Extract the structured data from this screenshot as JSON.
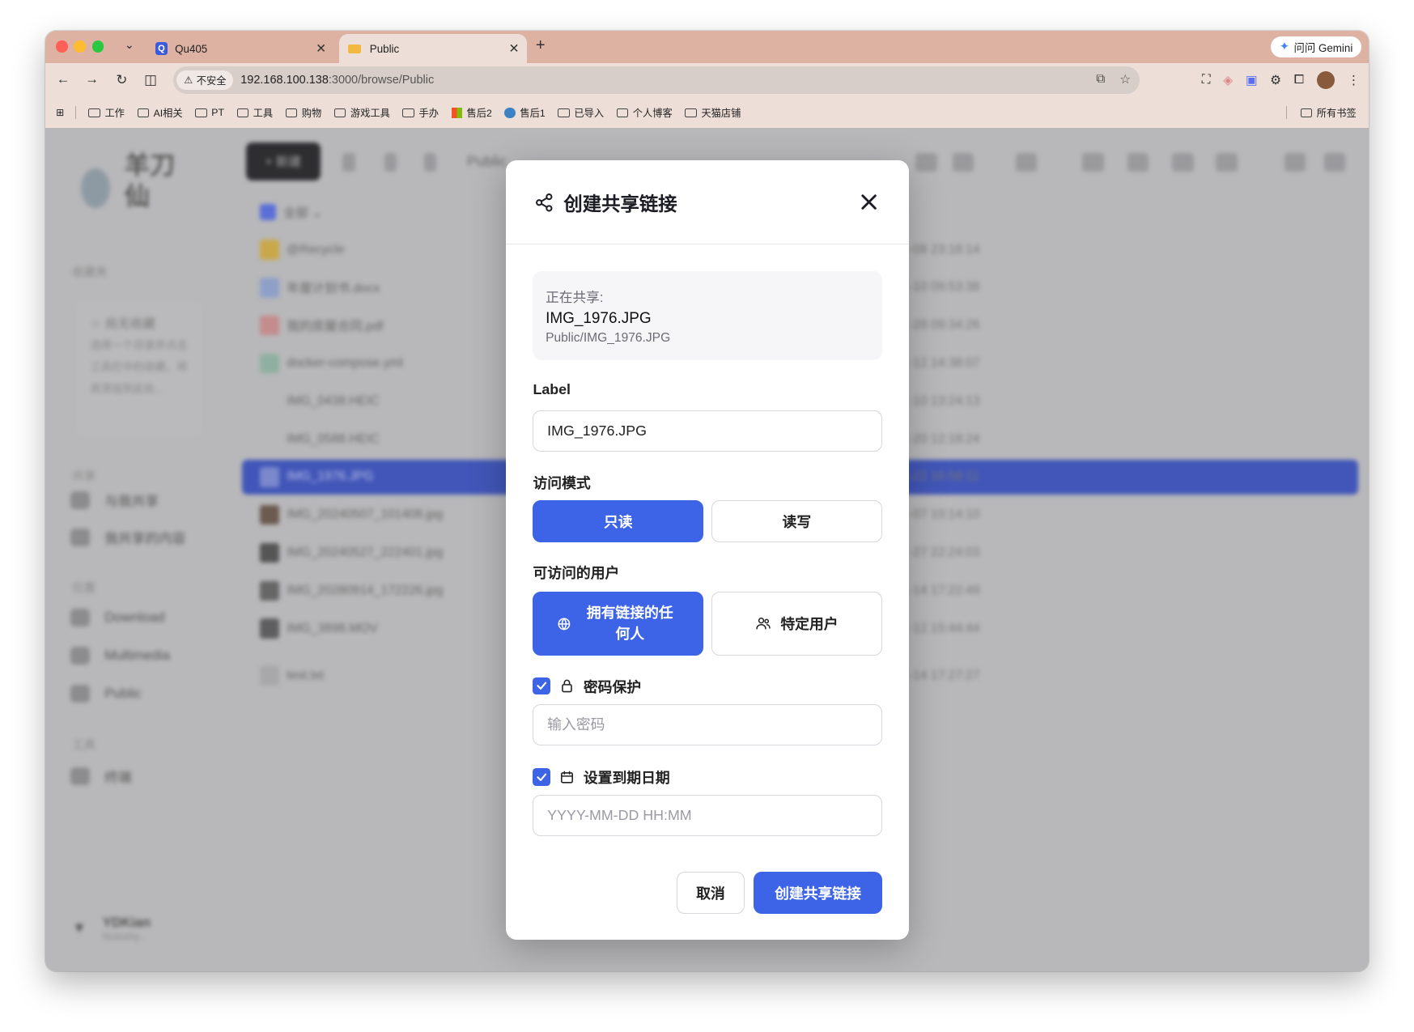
{
  "browser": {
    "tabs": [
      {
        "title": "Qu405"
      },
      {
        "title": "Public"
      }
    ],
    "gemini_label": "问问 Gemini",
    "address": {
      "insecure_label": "不安全",
      "host": "192.168.100.138",
      "rest": ":3000/browse/Public"
    },
    "bookmarks": [
      "工作",
      "AI相关",
      "PT",
      "工具",
      "购物",
      "游戏工具",
      "手办",
      "售后2",
      "售后1",
      "已导入",
      "个人博客",
      "天猫店铺"
    ],
    "bookmarks_all": "所有书签"
  },
  "background": {
    "app_name": "羊刀仙",
    "new_button": "+ 新建",
    "breadcrumb": "Public",
    "sidebar": {
      "section_favorites": "收藏夹",
      "favorites_title": "☆ 尚无收藏",
      "favorites_hint": "选择一个目录并点击工具栏中的收藏，将其添加到此处...",
      "section_shares": "共享",
      "shares_items": [
        "与我共享",
        "我共享的内容"
      ],
      "section_locations": "位置",
      "location_items": [
        "Download",
        "Multimedia",
        "Public"
      ],
      "section_tools": "工具",
      "tools_items": [
        "终端"
      ],
      "user_name": "YDKian",
      "user_sub": "Nutsdrty..."
    },
    "files": [
      {
        "name": "全部 ⌄",
        "date": ""
      },
      {
        "name": "@Recycle",
        "date": "-08 23:18:14"
      },
      {
        "name": "年度计划书.docx",
        "date": "-10 09:53:38"
      },
      {
        "name": "我的房屋合同.pdf",
        "date": "-28 09:34:26"
      },
      {
        "name": "docker-compose.yml",
        "date": "-12 14:38:07"
      },
      {
        "name": "IMG_0438.HEIC",
        "date": "-10 13:24:13"
      },
      {
        "name": "IMG_0588.HEIC",
        "date": "-20 12:18:24"
      },
      {
        "name": "IMG_1976.JPG",
        "date": "-22 16:58:11"
      },
      {
        "name": "IMG_20240507_101408.jpg",
        "date": "-07 10:14:10"
      },
      {
        "name": "IMG_20240527_222401.jpg",
        "date": "-27 22:24:03"
      },
      {
        "name": "IMG_20280914_172226.jpg",
        "date": "-14 17:22:49"
      },
      {
        "name": "IMG_3898.MOV",
        "date": "-12 15:44:44"
      },
      {
        "name": "test.txt",
        "date": "-14 17:27:27"
      }
    ]
  },
  "modal": {
    "title": "创建共享链接",
    "sharing_label": "正在共享:",
    "file_name": "IMG_1976.JPG",
    "file_path": "Public/IMG_1976.JPG",
    "label_field": {
      "label": "Label",
      "value": "IMG_1976.JPG"
    },
    "access_mode": {
      "label": "访问模式",
      "options": [
        "只读",
        "读写"
      ],
      "selected": "只读"
    },
    "access_users": {
      "label": "可访问的用户",
      "options": [
        "拥有链接的任何人",
        "特定用户"
      ],
      "selected": "拥有链接的任何人"
    },
    "password": {
      "label": "密码保护",
      "checked": true,
      "placeholder": "输入密码"
    },
    "expiry": {
      "label": "设置到期日期",
      "checked": true,
      "placeholder": "YYYY-MM-DD HH:MM"
    },
    "cancel_label": "取消",
    "create_label": "创建共享链接"
  },
  "colors": {
    "accent": "#3d63e6",
    "tab_bar": "#deb2a3",
    "overlay": "#b8b8ba"
  }
}
